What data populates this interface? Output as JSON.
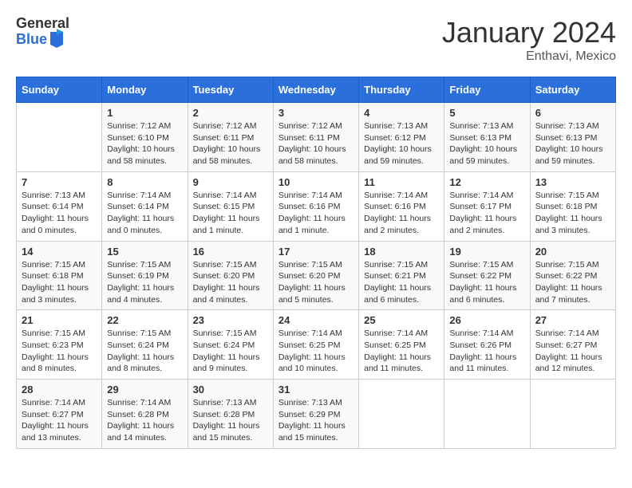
{
  "header": {
    "logo_general": "General",
    "logo_blue": "Blue",
    "title": "January 2024",
    "subtitle": "Enthavi, Mexico"
  },
  "days_of_week": [
    "Sunday",
    "Monday",
    "Tuesday",
    "Wednesday",
    "Thursday",
    "Friday",
    "Saturday"
  ],
  "weeks": [
    [
      {
        "day": "",
        "info": ""
      },
      {
        "day": "1",
        "info": "Sunrise: 7:12 AM\nSunset: 6:10 PM\nDaylight: 10 hours and 58 minutes."
      },
      {
        "day": "2",
        "info": "Sunrise: 7:12 AM\nSunset: 6:11 PM\nDaylight: 10 hours and 58 minutes."
      },
      {
        "day": "3",
        "info": "Sunrise: 7:12 AM\nSunset: 6:11 PM\nDaylight: 10 hours and 58 minutes."
      },
      {
        "day": "4",
        "info": "Sunrise: 7:13 AM\nSunset: 6:12 PM\nDaylight: 10 hours and 59 minutes."
      },
      {
        "day": "5",
        "info": "Sunrise: 7:13 AM\nSunset: 6:13 PM\nDaylight: 10 hours and 59 minutes."
      },
      {
        "day": "6",
        "info": "Sunrise: 7:13 AM\nSunset: 6:13 PM\nDaylight: 10 hours and 59 minutes."
      }
    ],
    [
      {
        "day": "7",
        "info": "Sunrise: 7:13 AM\nSunset: 6:14 PM\nDaylight: 11 hours and 0 minutes."
      },
      {
        "day": "8",
        "info": "Sunrise: 7:14 AM\nSunset: 6:14 PM\nDaylight: 11 hours and 0 minutes."
      },
      {
        "day": "9",
        "info": "Sunrise: 7:14 AM\nSunset: 6:15 PM\nDaylight: 11 hours and 1 minute."
      },
      {
        "day": "10",
        "info": "Sunrise: 7:14 AM\nSunset: 6:16 PM\nDaylight: 11 hours and 1 minute."
      },
      {
        "day": "11",
        "info": "Sunrise: 7:14 AM\nSunset: 6:16 PM\nDaylight: 11 hours and 2 minutes."
      },
      {
        "day": "12",
        "info": "Sunrise: 7:14 AM\nSunset: 6:17 PM\nDaylight: 11 hours and 2 minutes."
      },
      {
        "day": "13",
        "info": "Sunrise: 7:15 AM\nSunset: 6:18 PM\nDaylight: 11 hours and 3 minutes."
      }
    ],
    [
      {
        "day": "14",
        "info": "Sunrise: 7:15 AM\nSunset: 6:18 PM\nDaylight: 11 hours and 3 minutes."
      },
      {
        "day": "15",
        "info": "Sunrise: 7:15 AM\nSunset: 6:19 PM\nDaylight: 11 hours and 4 minutes."
      },
      {
        "day": "16",
        "info": "Sunrise: 7:15 AM\nSunset: 6:20 PM\nDaylight: 11 hours and 4 minutes."
      },
      {
        "day": "17",
        "info": "Sunrise: 7:15 AM\nSunset: 6:20 PM\nDaylight: 11 hours and 5 minutes."
      },
      {
        "day": "18",
        "info": "Sunrise: 7:15 AM\nSunset: 6:21 PM\nDaylight: 11 hours and 6 minutes."
      },
      {
        "day": "19",
        "info": "Sunrise: 7:15 AM\nSunset: 6:22 PM\nDaylight: 11 hours and 6 minutes."
      },
      {
        "day": "20",
        "info": "Sunrise: 7:15 AM\nSunset: 6:22 PM\nDaylight: 11 hours and 7 minutes."
      }
    ],
    [
      {
        "day": "21",
        "info": "Sunrise: 7:15 AM\nSunset: 6:23 PM\nDaylight: 11 hours and 8 minutes."
      },
      {
        "day": "22",
        "info": "Sunrise: 7:15 AM\nSunset: 6:24 PM\nDaylight: 11 hours and 8 minutes."
      },
      {
        "day": "23",
        "info": "Sunrise: 7:15 AM\nSunset: 6:24 PM\nDaylight: 11 hours and 9 minutes."
      },
      {
        "day": "24",
        "info": "Sunrise: 7:14 AM\nSunset: 6:25 PM\nDaylight: 11 hours and 10 minutes."
      },
      {
        "day": "25",
        "info": "Sunrise: 7:14 AM\nSunset: 6:25 PM\nDaylight: 11 hours and 11 minutes."
      },
      {
        "day": "26",
        "info": "Sunrise: 7:14 AM\nSunset: 6:26 PM\nDaylight: 11 hours and 11 minutes."
      },
      {
        "day": "27",
        "info": "Sunrise: 7:14 AM\nSunset: 6:27 PM\nDaylight: 11 hours and 12 minutes."
      }
    ],
    [
      {
        "day": "28",
        "info": "Sunrise: 7:14 AM\nSunset: 6:27 PM\nDaylight: 11 hours and 13 minutes."
      },
      {
        "day": "29",
        "info": "Sunrise: 7:14 AM\nSunset: 6:28 PM\nDaylight: 11 hours and 14 minutes."
      },
      {
        "day": "30",
        "info": "Sunrise: 7:13 AM\nSunset: 6:28 PM\nDaylight: 11 hours and 15 minutes."
      },
      {
        "day": "31",
        "info": "Sunrise: 7:13 AM\nSunset: 6:29 PM\nDaylight: 11 hours and 15 minutes."
      },
      {
        "day": "",
        "info": ""
      },
      {
        "day": "",
        "info": ""
      },
      {
        "day": "",
        "info": ""
      }
    ]
  ]
}
